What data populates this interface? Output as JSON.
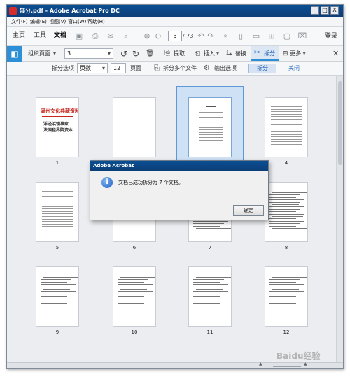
{
  "window": {
    "title": "部分.pdf - Adobe Acrobat Pro DC",
    "controls": [
      "_",
      "□",
      "X"
    ]
  },
  "menu": [
    "文件(F)",
    "编辑(E)",
    "视图(V)",
    "窗口(W)",
    "帮助(H)"
  ],
  "app_toolbar": {
    "tabs": [
      "主页",
      "工具",
      "文档"
    ],
    "active_tab": "文档",
    "page_current": "3",
    "page_total": "/ 73",
    "login": "登录",
    "icons": [
      "save-icon",
      "print-icon",
      "email-icon",
      "search-icon",
      "page-up-icon",
      "page-down-icon",
      "undo-icon",
      "redo-icon",
      "select-icon",
      "comment-icon",
      "highlight-icon",
      "read-mode-icon",
      "present-icon",
      "zoom-icon"
    ]
  },
  "organize_toolbar": {
    "title": "组织页面",
    "title_arrow": "▾",
    "page_select": "3",
    "extract": "提取",
    "insert": "插入",
    "replace": "替换",
    "split": "拆分",
    "more": "更多"
  },
  "split_toolbar": {
    "options_label": "拆分选项",
    "mode": "页数",
    "count": "12",
    "count_unit": "页面",
    "multi_files": "拆分多个文件",
    "output": "输出选项",
    "split": "拆分",
    "close": "关闭"
  },
  "pages": [
    {
      "num": "1"
    },
    {
      "num": "2"
    },
    {
      "num": "3"
    },
    {
      "num": "4"
    },
    {
      "num": "5"
    },
    {
      "num": "6"
    },
    {
      "num": "7"
    },
    {
      "num": "8"
    },
    {
      "num": "9"
    },
    {
      "num": "10"
    },
    {
      "num": "11"
    },
    {
      "num": "12"
    }
  ],
  "cover_page": {
    "line1": "满州文化典藏资料",
    "line2": "洋泾浜领事家",
    "line3": "法国租界院资本"
  },
  "selected_page": "3",
  "dialog": {
    "title": "Adobe Acrobat",
    "message": "文档已成功拆分为 7 个文档。",
    "ok": "确定"
  },
  "watermark": "Baidu经验"
}
